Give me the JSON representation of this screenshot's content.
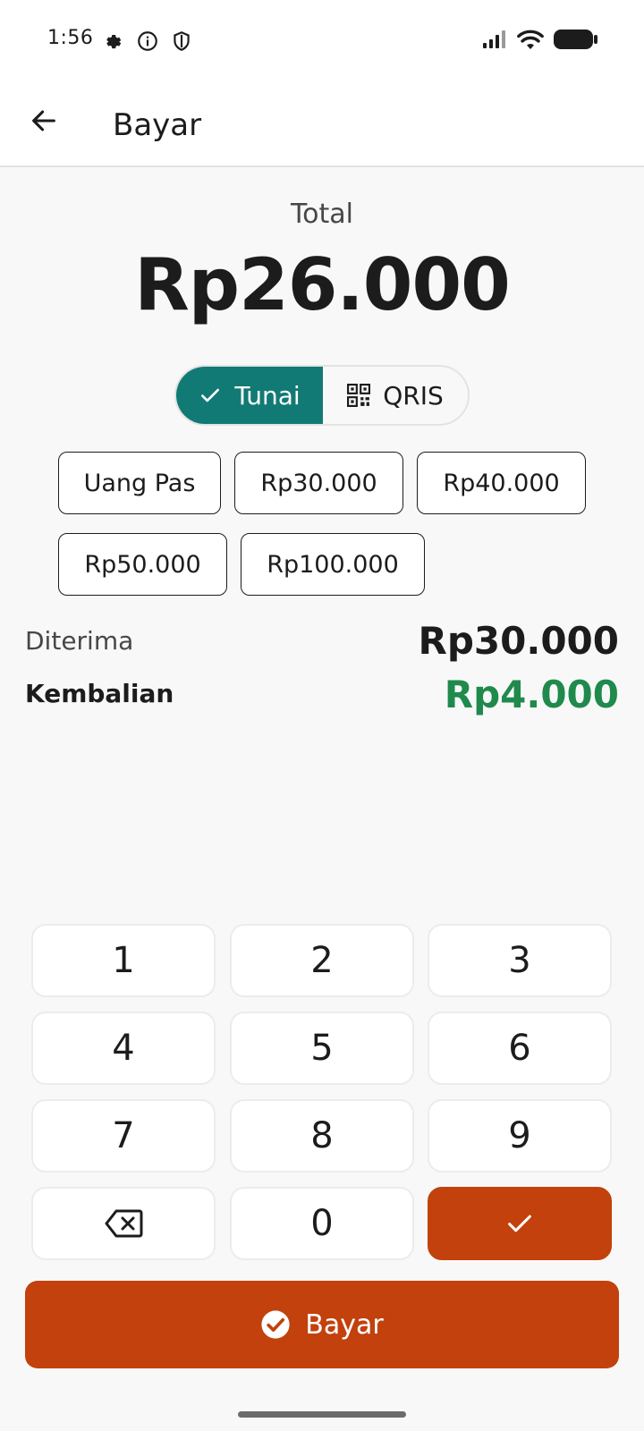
{
  "status_bar": {
    "time": "1:56",
    "left_icons": [
      "settings-icon",
      "info-icon",
      "shield-icon"
    ],
    "right_icons": [
      "signal-icon",
      "wifi-icon",
      "battery-icon"
    ]
  },
  "app_bar": {
    "back_icon": "arrow-left-icon",
    "title": "Bayar"
  },
  "total": {
    "label": "Total",
    "value": "Rp26.000"
  },
  "payment_methods": [
    {
      "label": "Tunai",
      "selected": true,
      "icon": "check-icon"
    },
    {
      "label": "QRIS",
      "selected": false,
      "icon": "qr-code-icon"
    }
  ],
  "quick_amounts": [
    "Uang Pas",
    "Rp30.000",
    "Rp40.000",
    "Rp50.000",
    "Rp100.000"
  ],
  "received": {
    "label": "Diterima",
    "value": "Rp30.000"
  },
  "change": {
    "label": "Kembalian",
    "value": "Rp4.000"
  },
  "keypad": [
    "1",
    "2",
    "3",
    "4",
    "5",
    "6",
    "7",
    "8",
    "9",
    "backspace-icon",
    "0",
    "check-icon"
  ],
  "pay_button": {
    "label": "Bayar",
    "icon": "check-circle-icon"
  },
  "colors": {
    "primary_teal": "#127a74",
    "accent_orange": "#c2410c",
    "change_green": "#1f8a4c",
    "background": "#f8f8f8"
  }
}
